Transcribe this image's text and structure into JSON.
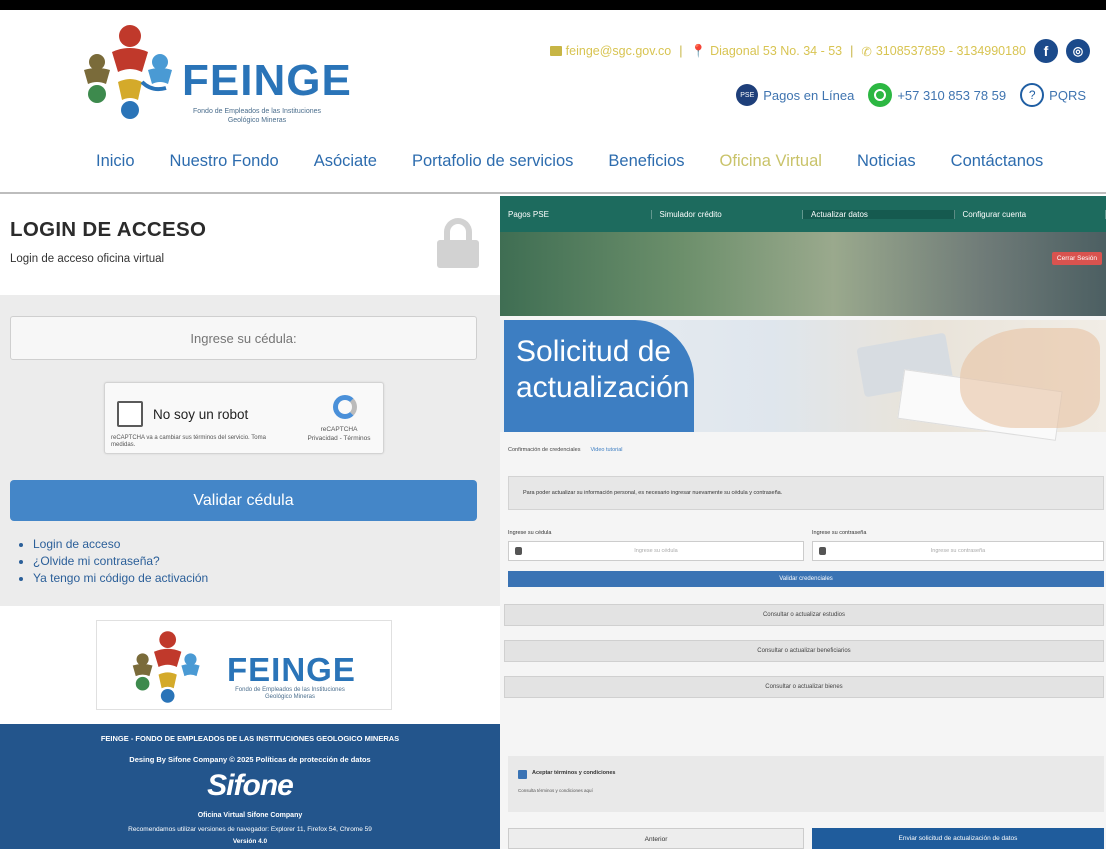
{
  "header": {
    "logo_text": "FEINGE",
    "logo_sub": "Fondo de Empleados de las Instituciones Geológico Mineras",
    "email": "feinge@sgc.gov.co",
    "address": "Diagonal 53 No. 34 - 53",
    "phones": "3108537859 - 3134990180",
    "pagos": "Pagos en Línea",
    "whatsapp": "+57 310 853 78 59",
    "pqrs": "PQRS",
    "nav": [
      "Inicio",
      "Nuestro Fondo",
      "Asóciate",
      "Portafolio de servicios",
      "Beneficios",
      "Oficina Virtual",
      "Noticias",
      "Contáctanos"
    ]
  },
  "login": {
    "title": "LOGIN DE ACCESO",
    "subtitle": "Login de acceso oficina virtual",
    "cedula_placeholder": "Ingrese su cédula:",
    "recaptcha_label": "No soy un robot",
    "recaptcha_terms": "reCAPTCHA va a cambiar sus términos del servicio. Toma medidas.",
    "recaptcha_brand": "reCAPTCHA",
    "recaptcha_privacy": "Privacidad - Términos",
    "validar": "Validar cédula",
    "links": [
      "Login de acceso",
      "¿Olvide mi contraseña?",
      "Ya tengo mi código de activación"
    ]
  },
  "footer": {
    "line1": "FEINGE - FONDO DE EMPLEADOS DE LAS INSTITUCIONES GEOLOGICO MINERAS",
    "line2": "Desing By Sifone Company © 2025   Políticas de protección de datos",
    "brand": "Sifone",
    "line3": "Oficina Virtual Sifone Company",
    "line4": "Recomendamos utilizar versiones de navegador: Explorer 11, Firefox 54, Chrome 59",
    "line5": "Versión 4.0"
  },
  "right": {
    "nav": [
      "Pagos PSE",
      "Simulador crédito",
      "Actualizar datos",
      "Configurar cuenta"
    ],
    "cerrar": "Cerrar Sesión",
    "banner_title": "Solicitud de actualización",
    "crumb1": "Confirmación de credenciales",
    "crumb2": "Video tutorial",
    "info": "Para poder actualizar su información personal, es necesario ingresar nuevamente su cédula y contraseña.",
    "label_cedula": "Ingrese su cédula",
    "label_pass": "Ingrese su contraseña",
    "ph_cedula": "Ingrese su cédula",
    "ph_pass": "Ingrese su contraseña",
    "validar_cred": "Validar credenciales",
    "acc1": "Consultar o actualizar estudios",
    "acc2": "Consultar o actualizar beneficiarios",
    "acc3": "Consultar o actualizar bienes",
    "terms": "Aceptar términos y condiciones",
    "terms_sub": "Consulta términos y condiciones aquí",
    "btn_prev": "Anterior",
    "btn_send": "Enviar solicitud de actualización de datos"
  }
}
